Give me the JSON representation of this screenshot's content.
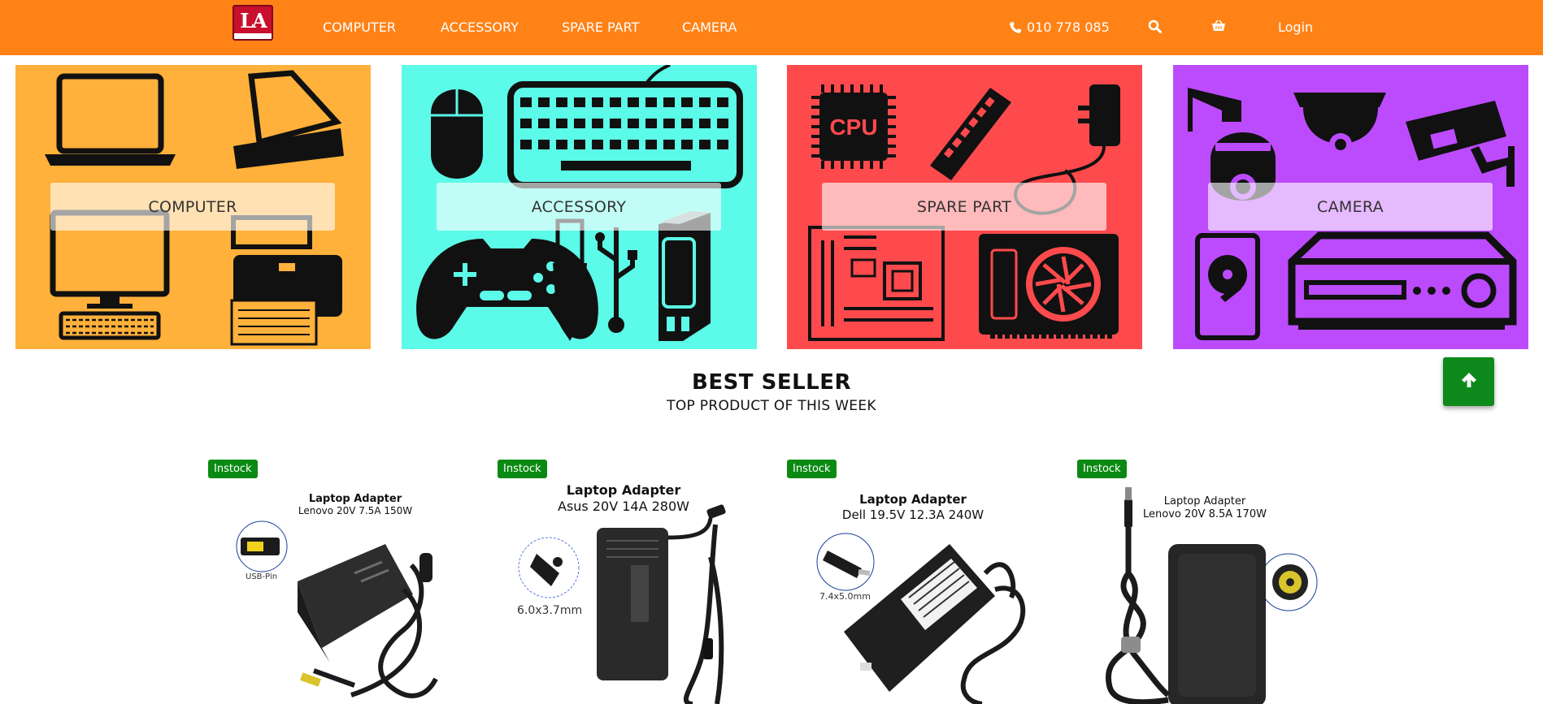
{
  "brand": {
    "logo_text": "LA"
  },
  "nav": {
    "links": [
      "COMPUTER",
      "ACCESSORY",
      "SPARE PART",
      "CAMERA"
    ],
    "phone": "010 778 085",
    "login": "Login"
  },
  "categories": [
    {
      "label": "COMPUTER",
      "color": "#ffb13b"
    },
    {
      "label": "ACCESSORY",
      "color": "#5cfae8"
    },
    {
      "label": "SPARE PART",
      "color": "#fe4a4d"
    },
    {
      "label": "CAMERA",
      "color": "#bc4bfd"
    }
  ],
  "cpu_chip_text": "CPU",
  "section": {
    "title": "BEST SELLER",
    "subtitle": "TOP PRODUCT OF THIS WEEK"
  },
  "products": [
    {
      "badge": "Instock",
      "title": "Laptop Adapter",
      "spec": "Lenovo 20V 7.5A 150W",
      "pin": "USB-Pin"
    },
    {
      "badge": "Instock",
      "title": "Laptop Adapter",
      "spec": "Asus 20V 14A 280W",
      "pin": "6.0x3.7mm"
    },
    {
      "badge": "Instock",
      "title": "Laptop Adapter",
      "spec": "Dell 19.5V 12.3A 240W",
      "pin": "7.4x5.0mm"
    },
    {
      "badge": "Instock",
      "title": "Laptop Adapter",
      "spec": "Lenovo 20V 8.5A 170W",
      "pin": ""
    }
  ],
  "colors": {
    "navbar": "#ff8217",
    "instock": "#0b8a13",
    "back_to_top": "#0d8a1b"
  }
}
